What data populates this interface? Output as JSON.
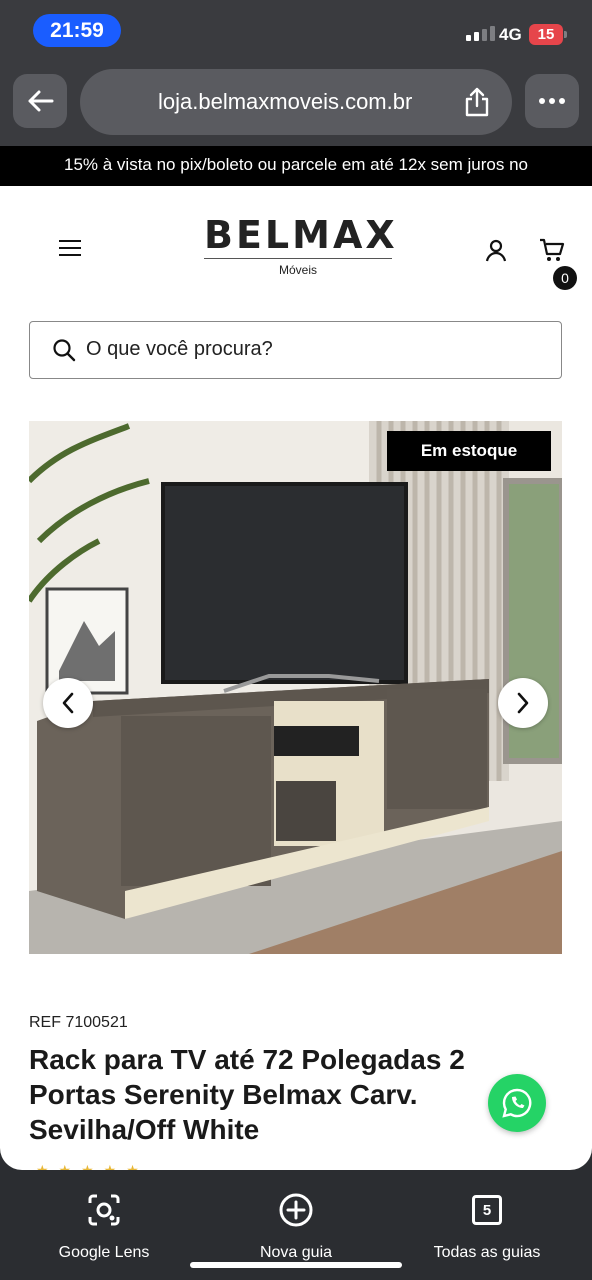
{
  "status": {
    "time": "21:59",
    "network": "4G",
    "battery": "15"
  },
  "browser": {
    "url": "loja.belmaxmoveis.com.br"
  },
  "promo": {
    "text": "15% à vista no pix/boleto ou parcele em até 12x sem juros no"
  },
  "header": {
    "logo": "BELMAX",
    "logo_sub": "Móveis",
    "cart_count": "0"
  },
  "search": {
    "placeholder": "O que você procura?"
  },
  "product": {
    "stock_badge": "Em estoque",
    "ref": "REF 7100521",
    "title": "Rack para TV até 72 Polegadas 2 Portas Serenity Belmax Carv. Sevilha/Off White",
    "rating": 5
  },
  "toolbar": {
    "lens": "Google Lens",
    "new_tab": "Nova guia",
    "tabs": "Todas as guias",
    "tab_count": "5"
  }
}
